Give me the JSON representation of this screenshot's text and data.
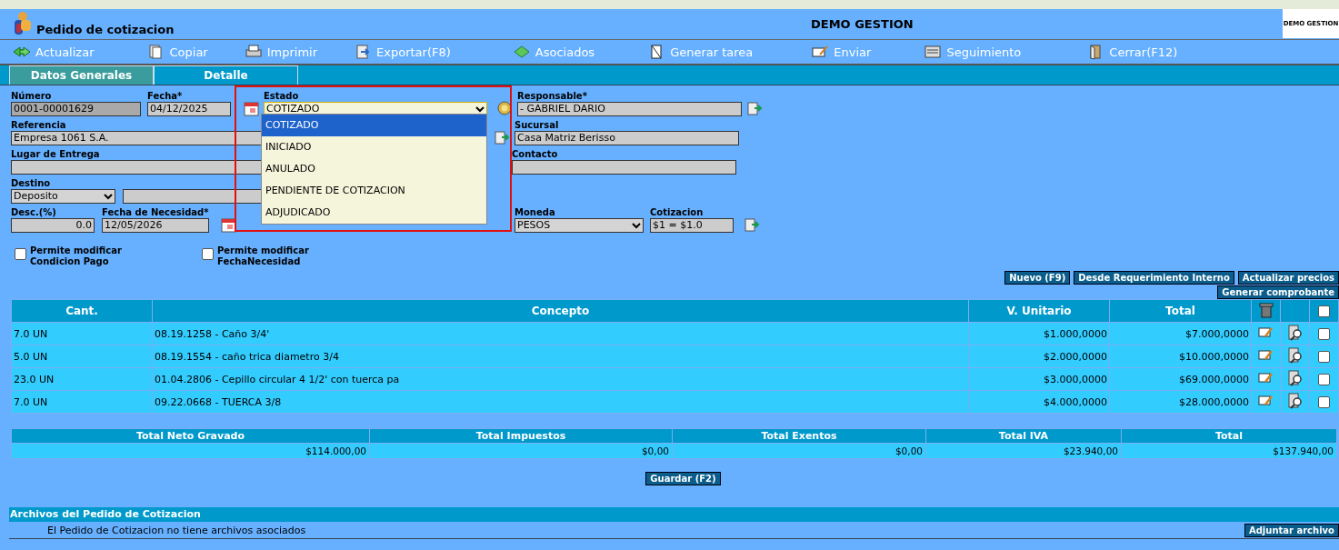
{
  "header": {
    "title": "Pedido de cotizacion",
    "company": "DEMO GESTION",
    "logo_text": "DEMO GESTION"
  },
  "toolbar": [
    {
      "label": "Actualizar",
      "kind": "refresh"
    },
    {
      "label": "Copiar",
      "kind": "copy"
    },
    {
      "label": "Imprimir",
      "kind": "print"
    },
    {
      "label": "Exportar(F8)",
      "kind": "export"
    },
    {
      "label": "Asociados",
      "kind": "link"
    },
    {
      "label": "Generar tarea",
      "kind": "task"
    },
    {
      "label": "Enviar",
      "kind": "send"
    },
    {
      "label": "Seguimiento",
      "kind": "track"
    },
    {
      "label": "Cerrar(F12)",
      "kind": "close"
    }
  ],
  "tabs": [
    {
      "label": "Datos Generales",
      "selected": true
    },
    {
      "label": "Detalle",
      "selected": false
    }
  ],
  "form": {
    "numero": {
      "label": "Número",
      "value": "0001-00001629"
    },
    "fecha": {
      "label": "Fecha*",
      "value": "04/12/2025"
    },
    "estado": {
      "label": "Estado",
      "value": "COTIZADO",
      "expanded": true,
      "options": [
        {
          "label": "COTIZADO",
          "selected": true
        },
        {
          "label": "INICIADO",
          "selected": false
        },
        {
          "label": "ANULADO",
          "selected": false
        },
        {
          "label": "PENDIENTE DE COTIZACION",
          "selected": false
        },
        {
          "label": "ADJUDICADO",
          "selected": false
        }
      ]
    },
    "responsable": {
      "label": "Responsable*",
      "value": "- GABRIEL DARIO"
    },
    "referencia": {
      "label": "Referencia",
      "value": "Empresa 1061 S.A."
    },
    "sucursal": {
      "label": "Sucursal",
      "value": "Casa Matriz Berisso"
    },
    "lugar_entrega": {
      "label": "Lugar de Entrega"
    },
    "contacto": {
      "label": "Contacto"
    },
    "destino": {
      "label": "Destino",
      "value": "Deposito"
    },
    "descuento": {
      "label": "Desc.(%)",
      "value": "0.0"
    },
    "fecha_necesidad": {
      "label": "Fecha de Necesidad*",
      "value": "12/05/2026"
    },
    "moneda": {
      "label": "Moneda",
      "value": "PESOS"
    },
    "cotizacion": {
      "label": "Cotizacion",
      "value": "$1 = $1.0"
    }
  },
  "checkboxes": [
    {
      "label": "Permite modificar Condicion Pago",
      "checked": false
    },
    {
      "label": "Permite modificar FechaNecesidad",
      "checked": false
    }
  ],
  "action_buttons": [
    "Nuevo (F9)",
    "Desde Requerimiento Interno",
    "Actualizar precios",
    "Generar comprobante"
  ],
  "items": {
    "columns": [
      "Cant.",
      "Concepto",
      "V. Unitario",
      "Total"
    ],
    "select_all": false,
    "rows": [
      {
        "cant": "7.0 UN",
        "concepto": "08.19.1258 - Caño 3/4'",
        "unitario": "$1.000,0000",
        "total": "$7.000,0000",
        "checked": false
      },
      {
        "cant": "5.0 UN",
        "concepto": "08.19.1554 - caño trica diametro 3/4",
        "unitario": "$2.000,0000",
        "total": "$10.000,0000",
        "checked": false
      },
      {
        "cant": "23.0 UN",
        "concepto": "01.04.2806 - Cepillo circular 4 1/2' con tuerca pa",
        "unitario": "$3.000,0000",
        "total": "$69.000,0000",
        "checked": false
      },
      {
        "cant": "7.0 UN",
        "concepto": "09.22.0668 - TUERCA 3/8",
        "unitario": "$4.000,0000",
        "total": "$28.000,0000",
        "checked": false
      }
    ]
  },
  "totals": [
    {
      "label": "Total Neto Gravado",
      "value": "$114.000,00"
    },
    {
      "label": "Total Impuestos",
      "value": "$0,00"
    },
    {
      "label": "Total Exentos",
      "value": "$0,00"
    },
    {
      "label": "Total IVA",
      "value": "$23.940,00"
    },
    {
      "label": "Total",
      "value": "$137.940,00"
    }
  ],
  "save_button": "Guardar (F2)",
  "files": {
    "title": "Archivos del Pedido de Cotizacion",
    "message": "El Pedido de Cotizacion no tiene archivos asociados",
    "button": "Adjuntar archivo"
  }
}
